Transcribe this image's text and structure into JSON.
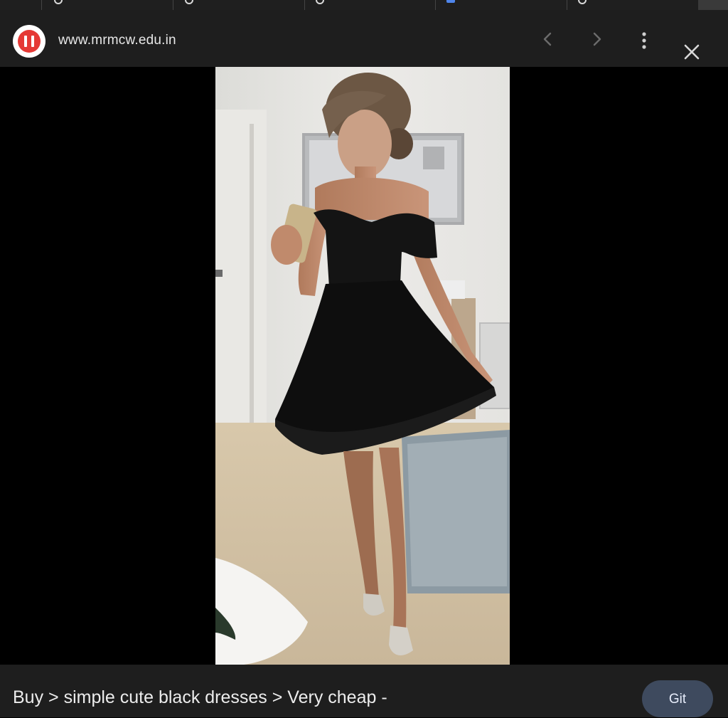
{
  "browser": {
    "url": "www.mrmcw.edu.in",
    "site_icon": "site-favicon",
    "back_icon": "chevron-left-icon",
    "forward_icon": "chevron-right-icon",
    "menu_icon": "more-vert-icon",
    "close_icon": "close-icon"
  },
  "image": {
    "subject": "photo"
  },
  "footer": {
    "caption": "Buy > simple cute black dresses > Very cheap -",
    "visit_label": "Git"
  },
  "colors": {
    "header_bg": "#1e1e1e",
    "page_bg": "#000000",
    "button_bg": "#3e4a5e",
    "logo_red": "#e53935"
  }
}
